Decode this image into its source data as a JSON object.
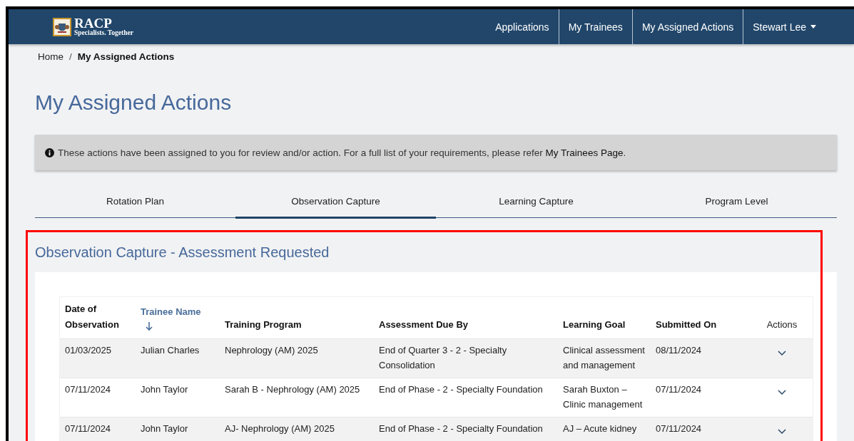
{
  "logo": {
    "name": "RACP",
    "tagline": "Specialists. Together"
  },
  "nav": [
    {
      "label": "Applications",
      "kind": "link"
    },
    {
      "label": "My Trainees",
      "kind": "link"
    },
    {
      "label": "My Assigned Actions",
      "kind": "link"
    },
    {
      "label": "Stewart Lee",
      "kind": "dropdown"
    }
  ],
  "breadcrumb": {
    "separator": "/",
    "items": [
      {
        "label": "Home",
        "current": false
      },
      {
        "label": "My Assigned Actions",
        "current": true
      }
    ]
  },
  "title": "My Assigned Actions",
  "notice": {
    "text": "These actions have been assigned to you for review and/or action. For a full list of your requirements, please refer ",
    "link": "My Trainees Page",
    "after": "."
  },
  "tabs": [
    {
      "label": "Rotation Plan",
      "selected": false
    },
    {
      "label": "Observation Capture",
      "selected": true
    },
    {
      "label": "Learning Capture",
      "selected": false
    },
    {
      "label": "Program Level",
      "selected": false
    }
  ],
  "section_title": "Observation Capture - Assessment Requested",
  "table": {
    "columns": [
      {
        "label": "Date of Observation",
        "kind": "data",
        "sorted": false
      },
      {
        "label": "Trainee Name",
        "kind": "data",
        "sorted": true
      },
      {
        "label": "Training Program",
        "kind": "data",
        "sorted": false
      },
      {
        "label": "Assessment Due By",
        "kind": "data",
        "sorted": false
      },
      {
        "label": "Learning Goal",
        "kind": "data",
        "sorted": false
      },
      {
        "label": "Submitted On",
        "kind": "data",
        "sorted": false
      },
      {
        "label": "Actions",
        "kind": "actions"
      }
    ],
    "rows": [
      {
        "cells": [
          "01/03/2025",
          "Julian Charles",
          "Nephrology (AM) 2025",
          "End of Quarter 3 - 2 - Specialty Consolidation",
          "Clinical assessment and management",
          "08/11/2024"
        ]
      },
      {
        "cells": [
          "07/11/2024",
          "John Taylor",
          "Sarah B - Nephrology (AM) 2025",
          "End of Phase - 2 - Specialty Foundation",
          "Sarah Buxton – Clinic management",
          "07/11/2024"
        ]
      },
      {
        "cells": [
          "07/11/2024",
          "John Taylor",
          "AJ- Nephrology (AM) 2025",
          "End of Phase - 2 - Specialty Foundation",
          "AJ – Acute kidney",
          "07/11/2024"
        ]
      }
    ]
  }
}
